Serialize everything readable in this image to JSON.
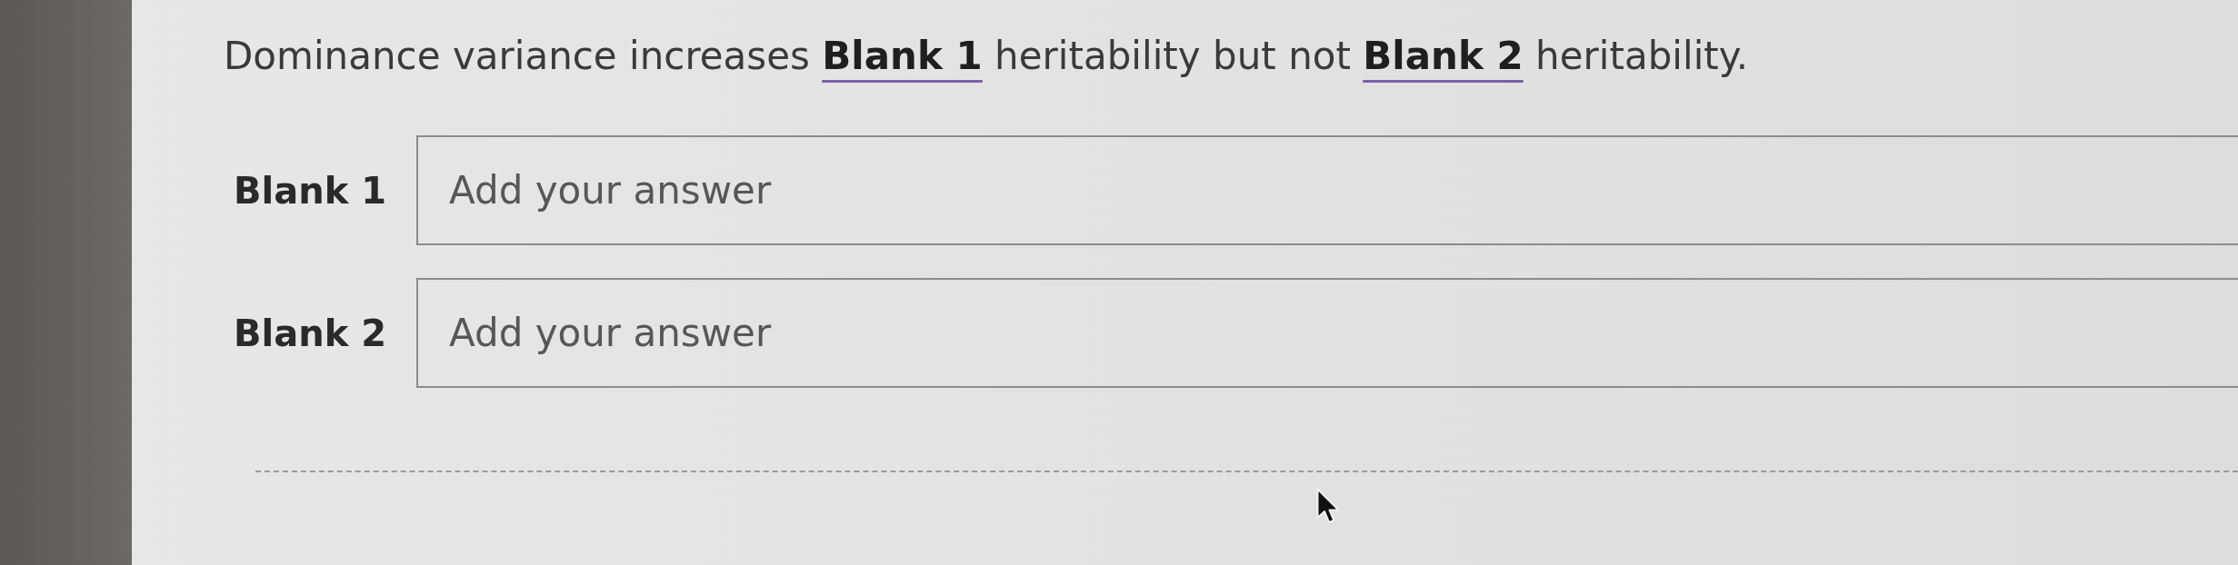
{
  "question": {
    "text": "Dominance variance increases **Blank 1** heritability but not **Blank 2** heritability."
  },
  "blanks": [
    {
      "label": "Blank 1",
      "placeholder": "Add your answer"
    },
    {
      "label": "Blank 2",
      "placeholder": "Add your answer"
    }
  ]
}
